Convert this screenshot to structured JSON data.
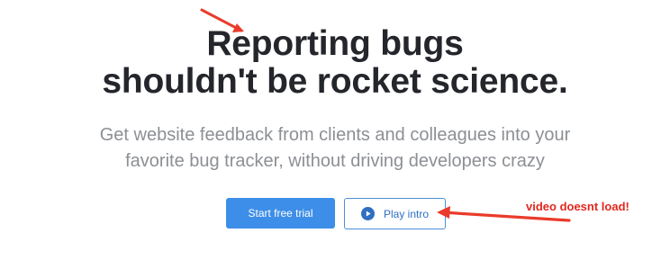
{
  "hero": {
    "title_line_1": "Reporting bugs",
    "title_line_2": "shouldn't be rocket science.",
    "subtitle_line_1": "Get website feedback from clients and colleagues into your",
    "subtitle_line_2": "favorite bug tracker, without driving developers crazy"
  },
  "actions": {
    "start_trial_label": "Start free trial",
    "play_intro_label": "Play intro",
    "play_intro_icon": "play-circle-icon"
  },
  "annotation": {
    "note": "video doesnt load!",
    "color": "#e3271d"
  },
  "colors": {
    "heading": "#24262c",
    "subtitle": "#8c8f94",
    "primary_button": "#3d8ee8",
    "secondary_button_text": "#2d6fc4"
  }
}
